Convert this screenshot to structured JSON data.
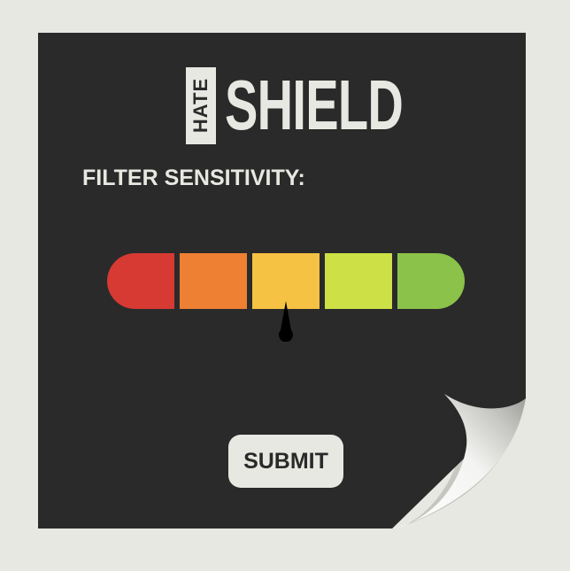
{
  "logo": {
    "prefix": "HATE",
    "name": "SHIELD"
  },
  "filter": {
    "label": "FILTER SENSITIVITY:",
    "levels": [
      {
        "color": "#d63a33"
      },
      {
        "color": "#ee8033"
      },
      {
        "color": "#f6c243"
      },
      {
        "color": "#cde046"
      },
      {
        "color": "#8bc24a"
      }
    ],
    "selected_level": 3,
    "level_count": 5
  },
  "submit": {
    "label": "SUBMIT"
  },
  "colors": {
    "background": "#e8e8e2",
    "card": "#2a2a2a",
    "text_light": "#e8e8e2",
    "pointer": "#000000"
  }
}
